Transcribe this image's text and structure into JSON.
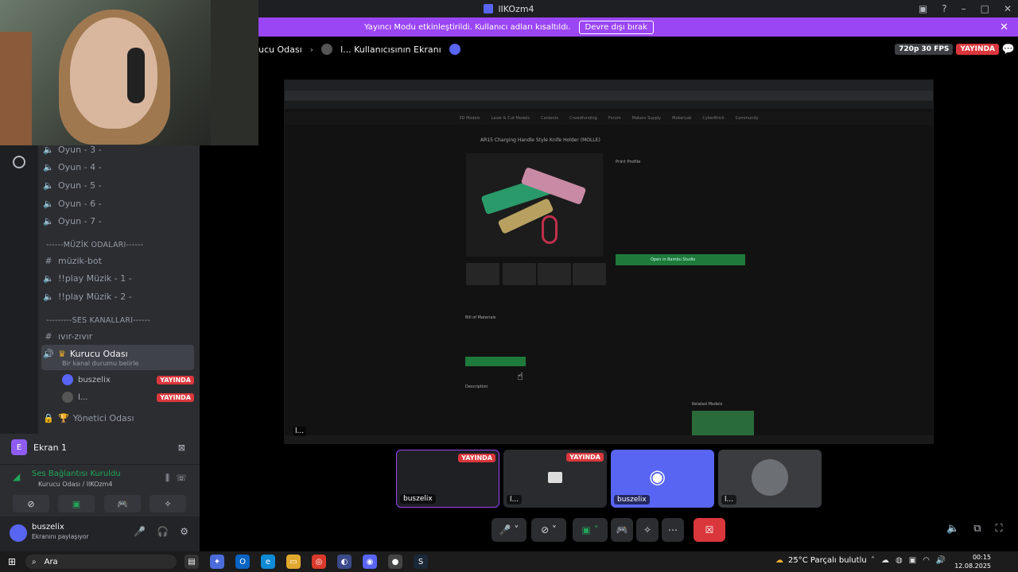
{
  "window": {
    "title": "lIKOzm4"
  },
  "banner": {
    "text": "Yayıncı Modu etkinleştirildi. Kullanıcı adları kısaltıldı.",
    "button": "Devre dışı bırak"
  },
  "sidebar": {
    "voice_channels_top": [
      "Oyun - 3 -",
      "Oyun - 4 -",
      "Oyun - 5 -",
      "Oyun - 6 -",
      "Oyun - 7 -"
    ],
    "music_category": "------MÜZİK ODALARI------",
    "music_channels": [
      {
        "name": "müzik-bot",
        "type": "text"
      },
      {
        "name": "!!play Müzik - 1 -",
        "type": "voice"
      },
      {
        "name": "!!play Müzik - 2 -",
        "type": "voice"
      }
    ],
    "voice_category": "---------SES KANALLARI------",
    "text_channel": "ıvır-zıvır",
    "active_channel": {
      "name": "Kurucu Odası",
      "status_hint": "Bir kanal durumu belirle"
    },
    "members": [
      {
        "name": "buszelix",
        "badge": "YAYINDA"
      },
      {
        "name": "l...",
        "badge": "YAYINDA"
      }
    ],
    "admin_channel": "Yönetici Odası"
  },
  "screen_panel": {
    "badge": "E",
    "label": "Ekran 1"
  },
  "voice_panel": {
    "title": "Ses Bağlantısı Kuruldu",
    "subtitle": "Kurucu Odası / lIKOzm4"
  },
  "user_panel": {
    "name": "buszelix",
    "status": "Ekranını paylaşıyor"
  },
  "stage": {
    "channel": "ucu Odası",
    "separator": "›",
    "stream_title": "l... Kullanıcısının Ekranı",
    "quality": "720p 30 FPS",
    "live": "YAYINDA",
    "stream_owner": "l..."
  },
  "stream_content": {
    "product_title": "AR15 Charging Handle Style Knife Holder (MOLLE)",
    "print_profile": "Print Profile",
    "open_button": "Open in Bambu Studio",
    "bom_title": "Bill of Materials",
    "description_title": "Description",
    "related": "Related Models",
    "nav": [
      "3D Models",
      "Laser & Cut Models",
      "Contests",
      "Crowdfunding",
      "Forum",
      "Makers Supply",
      "MakerLab",
      "CyberBrick",
      "Community"
    ]
  },
  "tiles": [
    {
      "label": "buszelix",
      "live": "YAYINDA",
      "color": "#1f2024"
    },
    {
      "label": "l...",
      "live": "YAYINDA",
      "color": "#2a2b2e"
    },
    {
      "label": "buszelix",
      "color": "#5865f2"
    },
    {
      "label": "l...",
      "color": "#3a3c40"
    }
  ],
  "taskbar": {
    "search_placeholder": "Ara",
    "weather": "25°C  Parçalı bulutlu",
    "time": "00:15",
    "date": "12.08.2025"
  },
  "colors": {
    "accent": "#5865f2",
    "streamer_banner": "#9b46f5",
    "live_red": "#da373c",
    "connected_green": "#23a559"
  }
}
